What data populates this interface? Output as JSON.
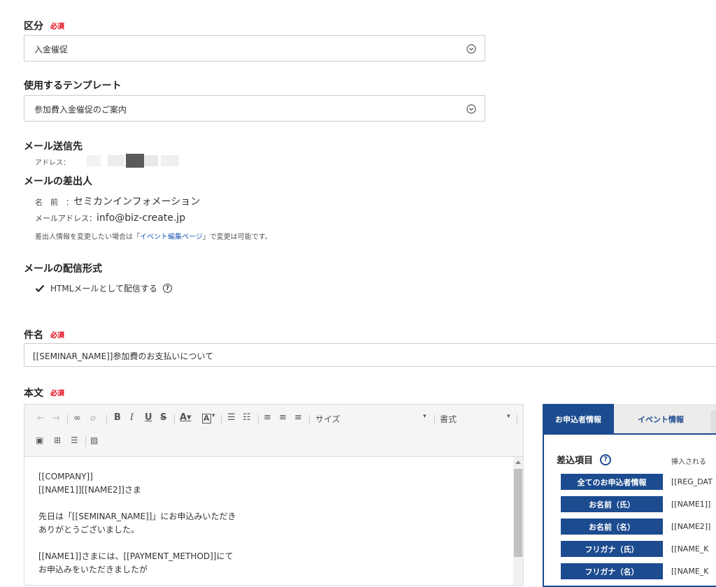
{
  "category": {
    "label": "区分",
    "required": "必須",
    "value": "入金催促"
  },
  "template": {
    "label": "使用するテンプレート",
    "value": "参加費入金催促のご案内"
  },
  "recipient": {
    "label": "メール送信先",
    "address_label": "アドレス："
  },
  "sender": {
    "label": "メールの差出人",
    "name_label": "名　前　：",
    "name_value": "セミカンインフォメーション",
    "email_label": "メールアドレス：",
    "email_value": "info@biz-create.jp",
    "note_before": "差出人情報を変更したい場合は「",
    "note_link": "イベント編集ページ",
    "note_after": "」で変更は可能です。"
  },
  "format": {
    "label": "メールの配信形式",
    "checkbox_label": "HTMLメールとして配信する",
    "help": "?"
  },
  "subject": {
    "label": "件名",
    "required": "必須",
    "value": "[[SEMINAR_NAME]]参加費のお支払いについて"
  },
  "body": {
    "label": "本文",
    "required": "必須",
    "toolbar": {
      "size": "サイズ",
      "style": "書式"
    },
    "lines": [
      "[[COMPANY]]",
      "[[NAME1]][[NAME2]]さま",
      "",
      "先日は「[[SEMINAR_NAME]]」にお申込みいただき",
      "ありがとうございました。",
      "",
      "[[NAME1]]さまには、[[PAYMENT_METHOD]]にて",
      "お申込みをいただきましたが"
    ]
  },
  "panel": {
    "tabs": [
      "お申込者情報",
      "イベント情報"
    ],
    "heading": "差込項目",
    "help": "?",
    "desc": "挿入される",
    "items": [
      {
        "label": "全てのお申込者情報",
        "code": "[[REG_DAT"
      },
      {
        "label": "お名前（氏）",
        "code": "[[NAME1]]"
      },
      {
        "label": "お名前（名）",
        "code": "[[NAME2]]"
      },
      {
        "label": "フリガナ（氏）",
        "code": "[[NAME_K"
      },
      {
        "label": "フリガナ（名）",
        "code": "[[NAME_K"
      }
    ]
  },
  "colors": {
    "accent": "#1c4b8f",
    "required": "#e60012",
    "link": "#1a56b6"
  }
}
